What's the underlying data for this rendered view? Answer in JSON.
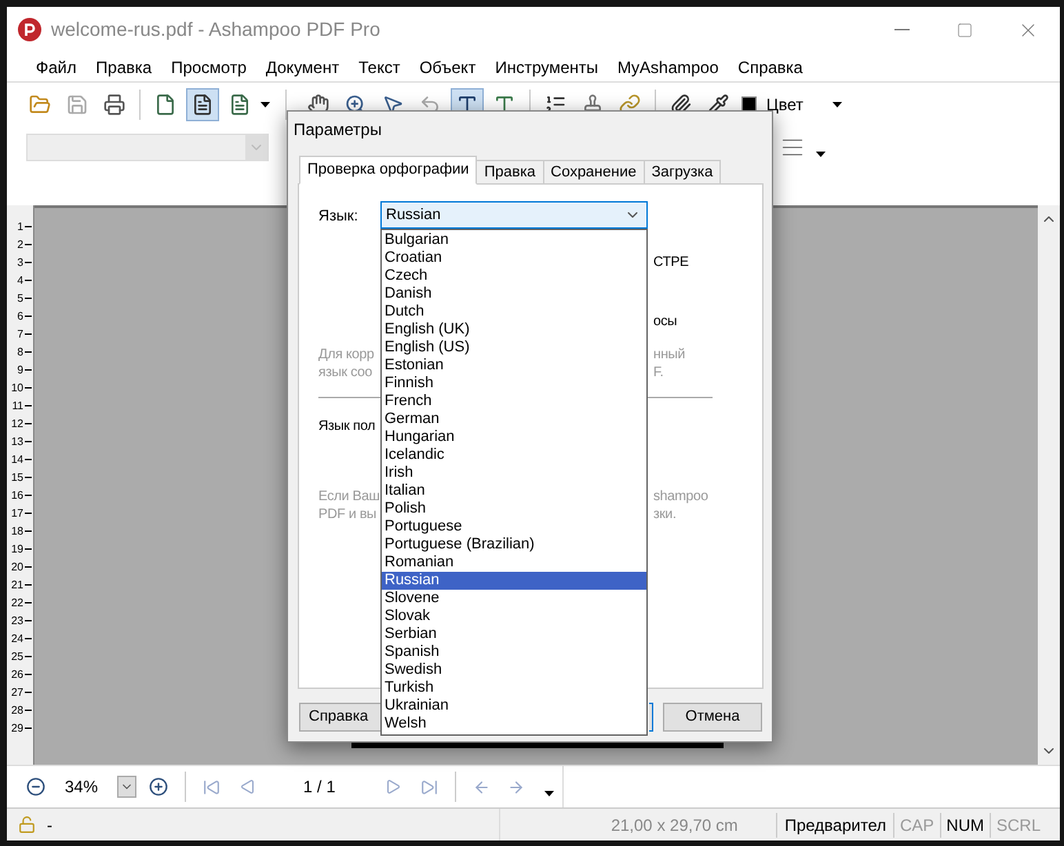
{
  "window": {
    "title": "welcome-rus.pdf - Ashampoo PDF Pro"
  },
  "menu": [
    "Файл",
    "Правка",
    "Просмотр",
    "Документ",
    "Текст",
    "Объект",
    "Инструменты",
    "MyAshampoo",
    "Справка"
  ],
  "toolbar": {
    "color_label": "Цвет"
  },
  "ruler": [
    "1",
    "2",
    "3",
    "4",
    "5",
    "6",
    "7",
    "8",
    "9",
    "10",
    "11",
    "12",
    "13",
    "14",
    "15",
    "16",
    "17",
    "18",
    "19",
    "20",
    "21",
    "22",
    "23",
    "24",
    "25",
    "26",
    "27",
    "28",
    "29"
  ],
  "dialog": {
    "title": "Параметры",
    "tabs": [
      {
        "label": "Проверка орфографии",
        "selected": true
      },
      {
        "label": "Правка",
        "selected": false
      },
      {
        "label": "Сохранение",
        "selected": false
      },
      {
        "label": "Загрузка",
        "selected": false
      }
    ],
    "language_label": "Язык:",
    "language_value": "Russian",
    "fragments": [
      "СТРЕ",
      "осы",
      "Для корр",
      "нный",
      "язык соо",
      "F.",
      "Язык пол",
      "Если Ваш",
      "shampoo",
      "PDF и вы",
      "зки."
    ],
    "languages": [
      {
        "label": "Bulgarian",
        "selected": false
      },
      {
        "label": "Croatian",
        "selected": false
      },
      {
        "label": "Czech",
        "selected": false
      },
      {
        "label": "Danish",
        "selected": false
      },
      {
        "label": "Dutch",
        "selected": false
      },
      {
        "label": "English (UK)",
        "selected": false
      },
      {
        "label": "English (US)",
        "selected": false
      },
      {
        "label": "Estonian",
        "selected": false
      },
      {
        "label": "Finnish",
        "selected": false
      },
      {
        "label": "French",
        "selected": false
      },
      {
        "label": "German",
        "selected": false
      },
      {
        "label": "Hungarian",
        "selected": false
      },
      {
        "label": "Icelandic",
        "selected": false
      },
      {
        "label": "Irish",
        "selected": false
      },
      {
        "label": "Italian",
        "selected": false
      },
      {
        "label": "Polish",
        "selected": false
      },
      {
        "label": "Portuguese",
        "selected": false
      },
      {
        "label": "Portuguese (Brazilian)",
        "selected": false
      },
      {
        "label": "Romanian",
        "selected": false
      },
      {
        "label": "Russian",
        "selected": true
      },
      {
        "label": "Slovene",
        "selected": false
      },
      {
        "label": "Slovak",
        "selected": false
      },
      {
        "label": "Serbian",
        "selected": false
      },
      {
        "label": "Spanish",
        "selected": false
      },
      {
        "label": "Swedish",
        "selected": false
      },
      {
        "label": "Turkish",
        "selected": false
      },
      {
        "label": "Ukrainian",
        "selected": false
      },
      {
        "label": "Welsh",
        "selected": false
      }
    ],
    "help_button": "Справка",
    "cancel_button": "Отмена"
  },
  "navigation": {
    "zoom": "34%",
    "page": "1 / 1"
  },
  "status_bar": {
    "lock_text": "-",
    "page_size": "21,00 x 29,70 cm",
    "mode": "Предварител",
    "indicators": [
      {
        "label": "CAP",
        "on": false
      },
      {
        "label": "NUM",
        "on": true
      },
      {
        "label": "SCRL",
        "on": false
      }
    ]
  }
}
